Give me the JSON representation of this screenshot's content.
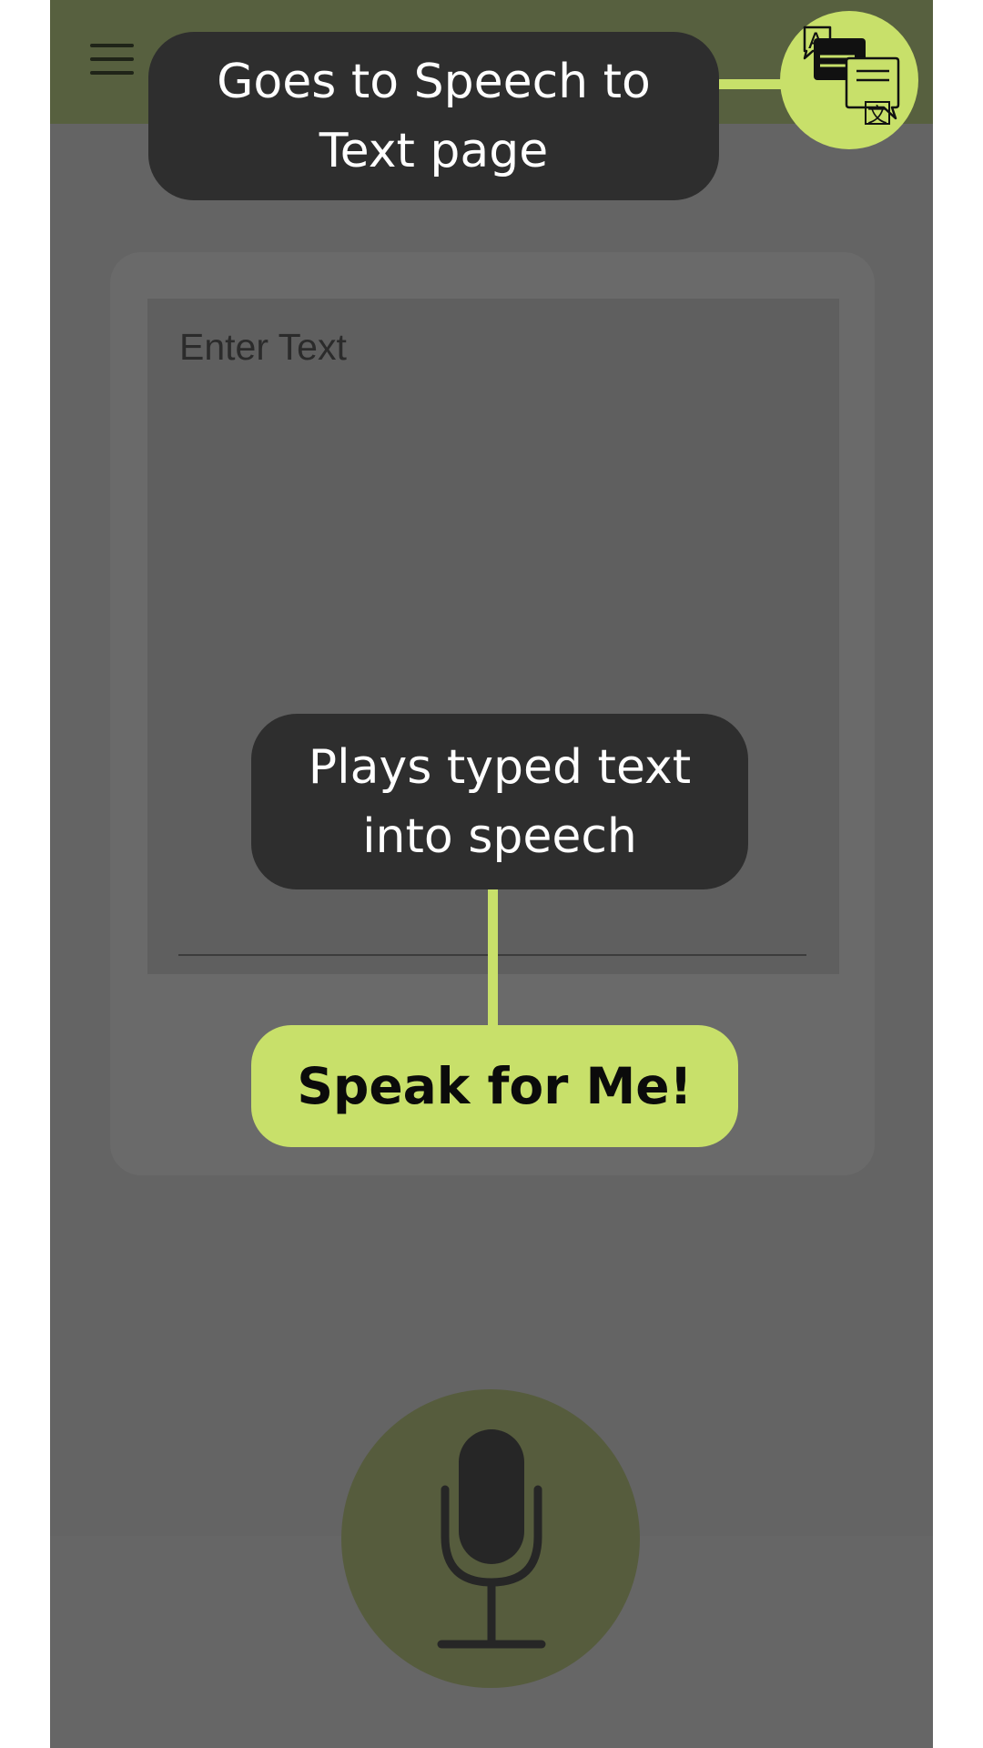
{
  "app_bar": {
    "menu_icon": "hamburger-menu-icon",
    "nav_icon": "translate-icon",
    "background_color": "#57603f"
  },
  "text_input": {
    "placeholder": "Enter Text",
    "value": ""
  },
  "speak_button": {
    "label": "Speak for Me!",
    "color": "#c8e06a"
  },
  "mic_button": {
    "icon": "microphone-icon",
    "color": "#565c3d"
  },
  "annotations": {
    "translate_tooltip": "Goes to Speech to Text page",
    "speak_tooltip": "Plays typed text into speech",
    "accent_color": "#c8e06a",
    "bubble_color": "#2e2e2e"
  }
}
